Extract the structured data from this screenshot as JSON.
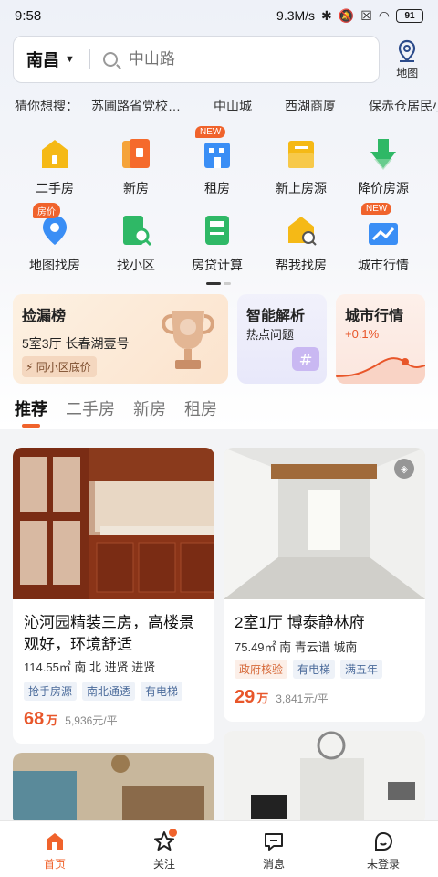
{
  "status_bar": {
    "time": "9:58",
    "speed": "9.3M/s",
    "battery": "91"
  },
  "search": {
    "city": "南昌",
    "placeholder": "中山路",
    "map_label": "地图"
  },
  "guess": {
    "label": "猜你想搜：",
    "keywords": [
      "苏圃路省党校…",
      "中山城",
      "西湖商厦",
      "保赤仓居民小区"
    ]
  },
  "grid": {
    "row1": [
      {
        "name": "二手房",
        "icon": "second-hand-house-icon",
        "color": "#f5b916"
      },
      {
        "name": "新房",
        "icon": "new-house-icon",
        "color": "#f56a2c"
      },
      {
        "name": "租房",
        "icon": "rent-icon",
        "color": "#3a8ef5",
        "badge": "NEW"
      },
      {
        "name": "新上房源",
        "icon": "new-listing-icon",
        "color": "#f5b916"
      },
      {
        "name": "降价房源",
        "icon": "price-drop-icon",
        "color": "#2fb866"
      }
    ],
    "row2": [
      {
        "name": "地图找房",
        "icon": "map-search-icon",
        "color": "#3a8ef5",
        "badge": "房价"
      },
      {
        "name": "找小区",
        "icon": "find-community-icon",
        "color": "#2fb866"
      },
      {
        "name": "房贷计算",
        "icon": "mortgage-calculator-icon",
        "color": "#2fb866"
      },
      {
        "name": "帮我找房",
        "icon": "help-find-icon",
        "color": "#f5b916"
      },
      {
        "name": "城市行情",
        "icon": "city-market-icon",
        "color": "#3a8ef5",
        "badge": "NEW"
      }
    ]
  },
  "promos": {
    "p1": {
      "title": "捡漏榜",
      "subtitle": "5室3厅 长春湖壹号",
      "pill": "同小区底价"
    },
    "p2": {
      "title": "智能解析",
      "subtitle": "热点问题"
    },
    "p3": {
      "title": "城市行情",
      "subtitle": "+0.1%"
    }
  },
  "tabs": [
    "推荐",
    "二手房",
    "新房",
    "租房"
  ],
  "listings": [
    {
      "title": "沁河园精装三房，高楼景观好，环境舒适",
      "meta": "114.55㎡  南 北  进贤 进贤",
      "tags": [
        "抢手房源",
        "南北通透",
        "有电梯"
      ],
      "price": "68",
      "price_unit": "万",
      "per": "5,936元/平"
    },
    {
      "title": "2室1厅 博泰静林府",
      "meta": "75.49㎡  南  青云谱 城南",
      "tags": [
        "政府核验",
        "有电梯",
        "满五年"
      ],
      "price": "29",
      "price_unit": "万",
      "per": "3,841元/平"
    }
  ],
  "nav": [
    "首页",
    "关注",
    "消息",
    "未登录"
  ],
  "colors": {
    "accent": "#f0632c",
    "price": "#e8562a"
  }
}
